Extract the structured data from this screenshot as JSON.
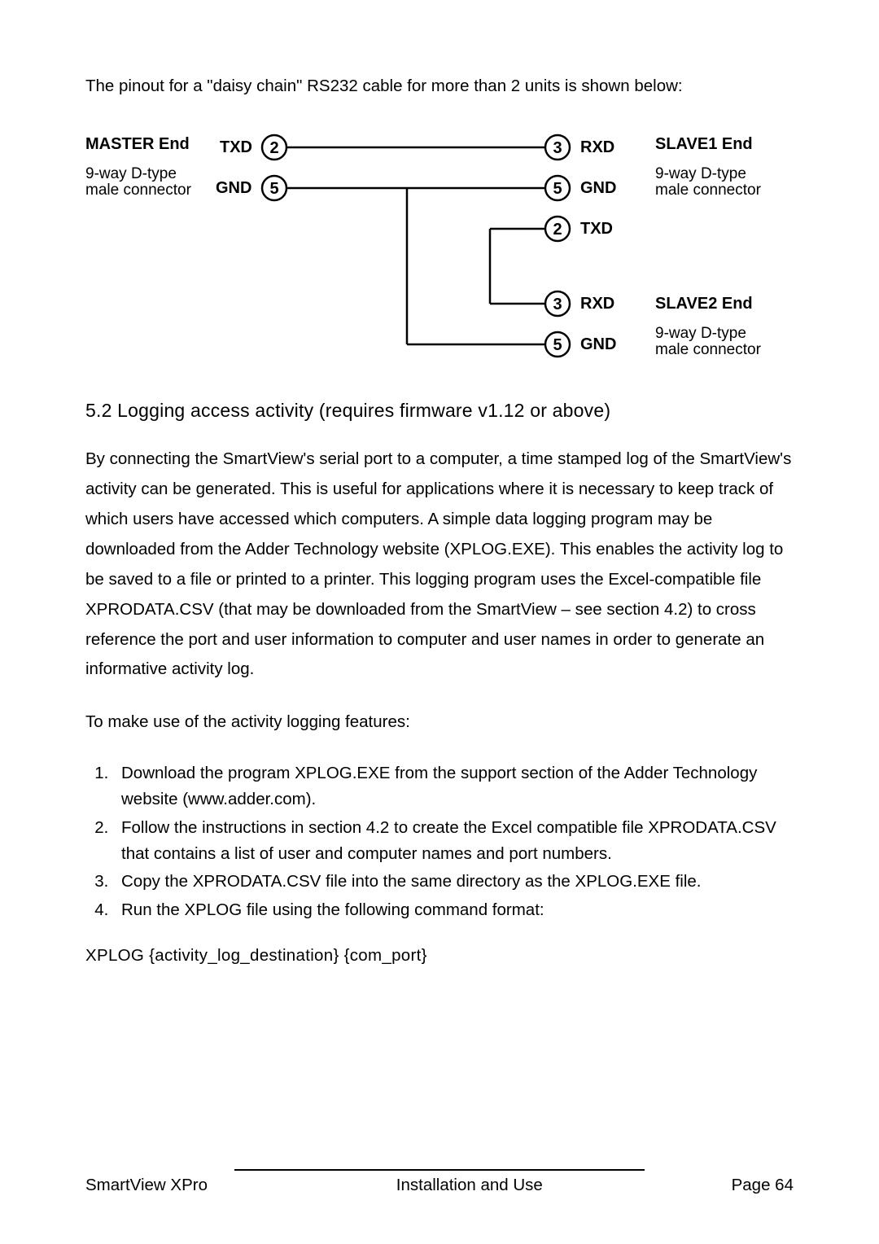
{
  "intro": "The pinout for a \"daisy chain\" RS232 cable for more than 2 units is shown below:",
  "diagram": {
    "master_title": "MASTER End",
    "master_sub1": "9-way D-type",
    "master_sub2": "male connector",
    "slave1_title": "SLAVE1 End",
    "slave1_sub1": "9-way D-type",
    "slave1_sub2": "male connector",
    "slave2_title": "SLAVE2 End",
    "slave2_sub1": "9-way D-type",
    "slave2_sub2": "male connector",
    "txd": "TXD",
    "gnd": "GND",
    "rxd": "RXD",
    "pin2": "2",
    "pin3": "3",
    "pin5": "5"
  },
  "section_title": "5.2 Logging access activity (requires firmware v1.12 or above)",
  "para1": "By connecting the SmartView's serial port to a computer, a time stamped log of the SmartView's activity can be generated. This is useful for applications where it is necessary to keep track of which users have accessed which computers. A simple data logging program may be downloaded from the Adder Technology website (XPLOG.EXE). This enables the activity log to be saved to a file or printed to a printer. This logging program uses the Excel-compatible file XPRODATA.CSV (that may be downloaded from the SmartView – see section 4.2) to cross reference the port and user information to computer and user names in order to generate an informative activity log.",
  "para2": "To make use of the activity logging features:",
  "list": {
    "item1": "Download the program XPLOG.EXE from the support section of the Adder Technology website (www.adder.com).",
    "item2": "Follow the instructions in section 4.2 to create the Excel compatible file XPRODATA.CSV that contains a list of user and computer names and port numbers.",
    "item3": "Copy the XPRODATA.CSV file into the same directory as the XPLOG.EXE file.",
    "item4": "Run the XPLOG file using the following command format:"
  },
  "command": "XPLOG  {activity_log_destination}  {com_port}",
  "footer": {
    "left": "SmartView XPro",
    "center": "Installation and Use",
    "right": "Page 64"
  }
}
